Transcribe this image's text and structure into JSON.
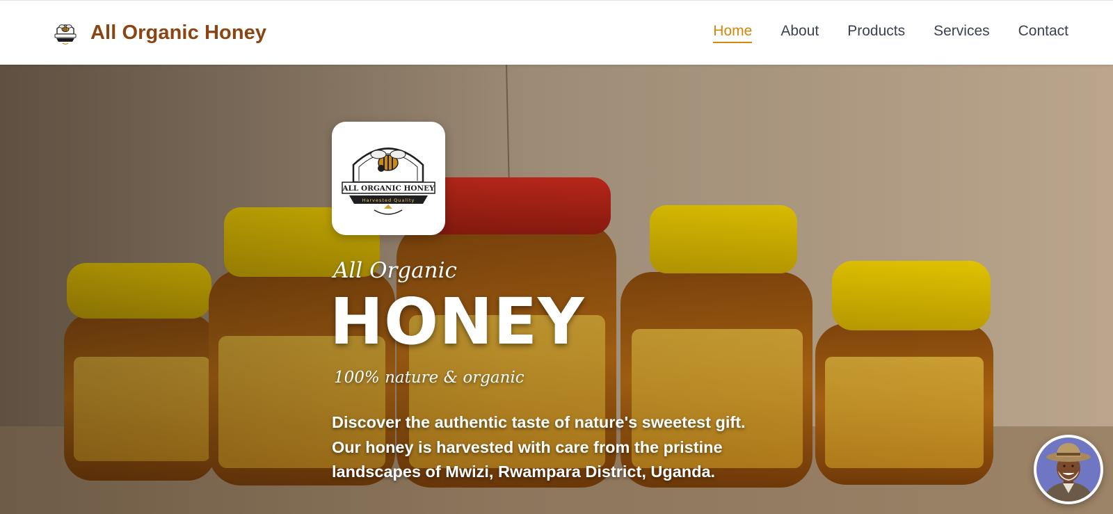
{
  "header": {
    "brand_name": "All Organic Honey",
    "logo_icon": "honey-bee-badge-icon",
    "nav": [
      {
        "label": "Home",
        "active": true
      },
      {
        "label": "About",
        "active": false
      },
      {
        "label": "Products",
        "active": false
      },
      {
        "label": "Services",
        "active": false
      },
      {
        "label": "Contact",
        "active": false
      }
    ]
  },
  "hero": {
    "badge_text": "ALL ORGANIC HONEY",
    "badge_subtext": "Harvested Quality",
    "script_top": "All Organic",
    "title": "HONEY",
    "script_bottom": "100% nature & organic",
    "description": "Discover the authentic taste of nature's sweetest gift. Our honey is harvested with care from the pristine landscapes of Mwizi, Rwampara District, Uganda.",
    "background_image": "honey-jars-photo"
  },
  "chat": {
    "avatar_icon": "farmer-avatar-icon"
  },
  "colors": {
    "brand": "#8b4513",
    "accent": "#d4870a",
    "nav_text": "#3a4150",
    "jar_lid_yellow": "#e8c200",
    "jar_lid_red": "#c0201a",
    "honey": "#c57a14"
  }
}
